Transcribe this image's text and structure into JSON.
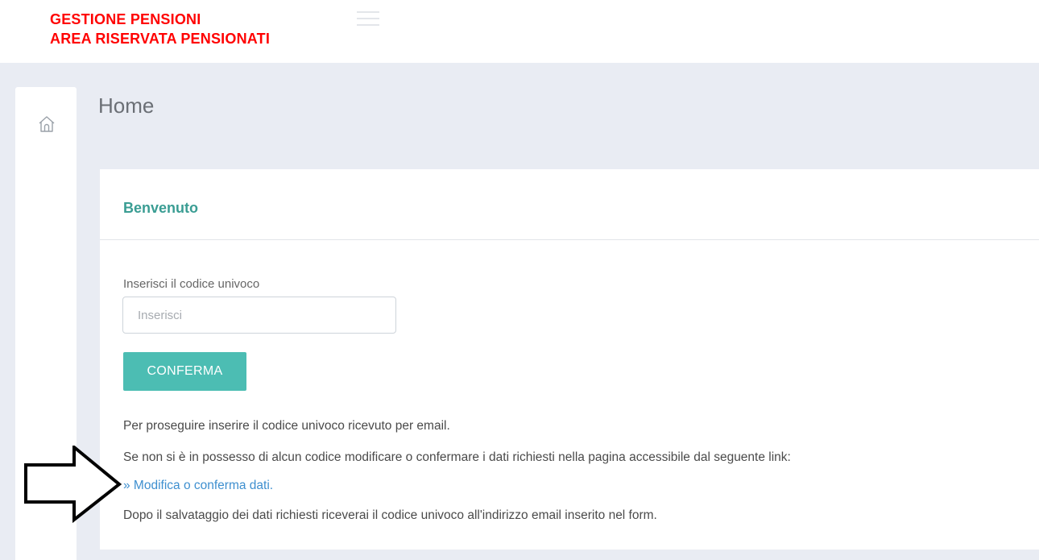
{
  "header": {
    "brand_line1": "GESTIONE PENSIONI",
    "brand_line2": "AREA RISERVATA PENSIONATI",
    "brand_color": "#ff0000",
    "menu_icon": "hamburger-icon"
  },
  "sidebar": {
    "items": [
      {
        "icon": "home-icon"
      }
    ]
  },
  "page": {
    "title": "Home"
  },
  "card": {
    "title": "Benvenuto",
    "accent_color": "#3a9d93",
    "code_field": {
      "label": "Inserisci il codice univoco",
      "placeholder": "Inserisci",
      "value": ""
    },
    "confirm_button": {
      "label": "CONFERMA",
      "color": "#4cbdb3"
    },
    "info": {
      "line1": "Per proseguire inserire il codice univoco ricevuto per email.",
      "line2": "Se non si è in possesso di alcun codice modificare o confermare i dati richiesti nella pagina accessibile dal seguente link:",
      "link_text": "» Modifica o conferma dati.",
      "line4": "Dopo il salvataggio dei dati richiesti riceverai il codice univoco all'indirizzo email inserito nel form."
    }
  },
  "annotation": {
    "icon": "arrow-right-icon"
  }
}
